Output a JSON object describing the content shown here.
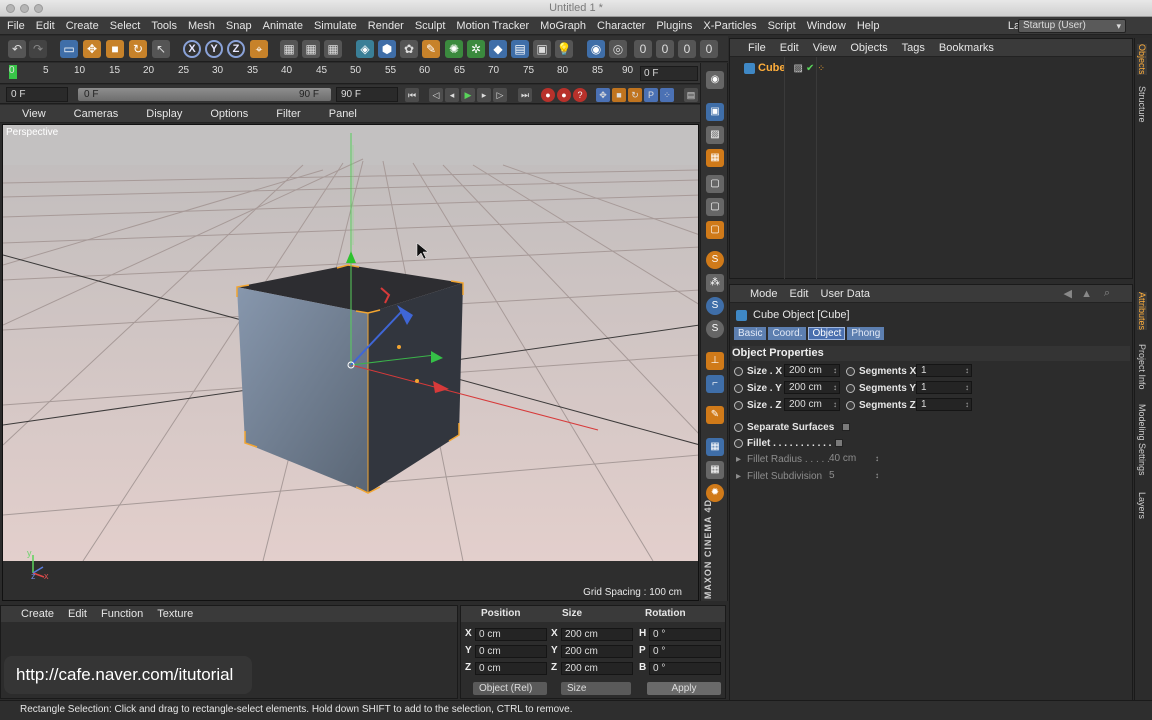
{
  "window": {
    "title": "Untitled 1 *"
  },
  "menubar": {
    "items": [
      "File",
      "Edit",
      "Create",
      "Select",
      "Tools",
      "Mesh",
      "Snap",
      "Animate",
      "Simulate",
      "Render",
      "Sculpt",
      "Motion Tracker",
      "MoGraph",
      "Character",
      "Plugins",
      "X-Particles",
      "Script",
      "Window",
      "Help"
    ],
    "layout_label": "Layout:",
    "layout_value": "Startup (User)"
  },
  "toolbar": {
    "axis_x": "X",
    "axis_y": "Y",
    "axis_z": "Z"
  },
  "timeline": {
    "ruler_ticks": [
      "0",
      "5",
      "10",
      "15",
      "20",
      "25",
      "30",
      "35",
      "40",
      "45",
      "50",
      "55",
      "60",
      "65",
      "70",
      "75",
      "80",
      "85",
      "90"
    ],
    "current_frame": "0 F",
    "start_frame": "0 F",
    "range_start": "0 F",
    "range_end": "90 F",
    "end_frame": "90 F"
  },
  "viewport": {
    "menu": [
      "View",
      "Cameras",
      "Display",
      "Options",
      "Filter",
      "Panel"
    ],
    "label": "Perspective",
    "grid_spacing": "Grid Spacing : 100 cm",
    "axis_labels": {
      "x": "x",
      "y": "y",
      "z": "z"
    }
  },
  "object_manager": {
    "menu": [
      "File",
      "Edit",
      "View",
      "Objects",
      "Tags",
      "Bookmarks"
    ],
    "objects": [
      {
        "name": "Cube"
      }
    ]
  },
  "attribute_manager": {
    "menu": [
      "Mode",
      "Edit",
      "User Data"
    ],
    "title": "Cube Object [Cube]",
    "tabs": [
      "Basic",
      "Coord.",
      "Object",
      "Phong"
    ],
    "active_tab": "Object",
    "section": "Object Properties",
    "size_x_label": "Size . X",
    "size_x": "200 cm",
    "size_y_label": "Size . Y",
    "size_y": "200 cm",
    "size_z_label": "Size . Z",
    "size_z": "200 cm",
    "seg_x_label": "Segments X",
    "seg_x": "1",
    "seg_y_label": "Segments Y",
    "seg_y": "1",
    "seg_z_label": "Segments Z",
    "seg_z": "1",
    "separate_surfaces": "Separate Surfaces",
    "fillet": "Fillet . . . . . . . . . . .",
    "fillet_radius_label": "Fillet Radius . . . . .",
    "fillet_radius": "40 cm",
    "fillet_subdiv_label": "Fillet Subdivision",
    "fillet_subdiv": "5"
  },
  "side_tabs": [
    "Objects",
    "Structure",
    "Attributes",
    "Project Info",
    "Modeling Settings",
    "Layers"
  ],
  "material_manager": {
    "menu": [
      "Create",
      "Edit",
      "Function",
      "Texture"
    ]
  },
  "coordinates": {
    "headers": {
      "position": "Position",
      "size": "Size",
      "rotation": "Rotation"
    },
    "rows": [
      {
        "pos_axis": "X",
        "pos": "0 cm",
        "size_axis": "X",
        "size": "200 cm",
        "rot_axis": "H",
        "rot": "0 °"
      },
      {
        "pos_axis": "Y",
        "pos": "0 cm",
        "size_axis": "Y",
        "size": "200 cm",
        "rot_axis": "P",
        "rot": "0 °"
      },
      {
        "pos_axis": "Z",
        "pos": "0 cm",
        "size_axis": "Z",
        "size": "200 cm",
        "rot_axis": "B",
        "rot": "0 °"
      }
    ],
    "mode": "Object (Rel)",
    "size_mode": "Size",
    "apply": "Apply"
  },
  "watermark": "http://cafe.naver.com/itutorial",
  "status": "Rectangle Selection: Click and drag to rectangle-select elements. Hold down SHIFT to add to the selection, CTRL to remove.",
  "colors": {
    "accent_blue": "#4a6fae",
    "object_orange": "#ffae3b",
    "play_green": "#38c548"
  }
}
